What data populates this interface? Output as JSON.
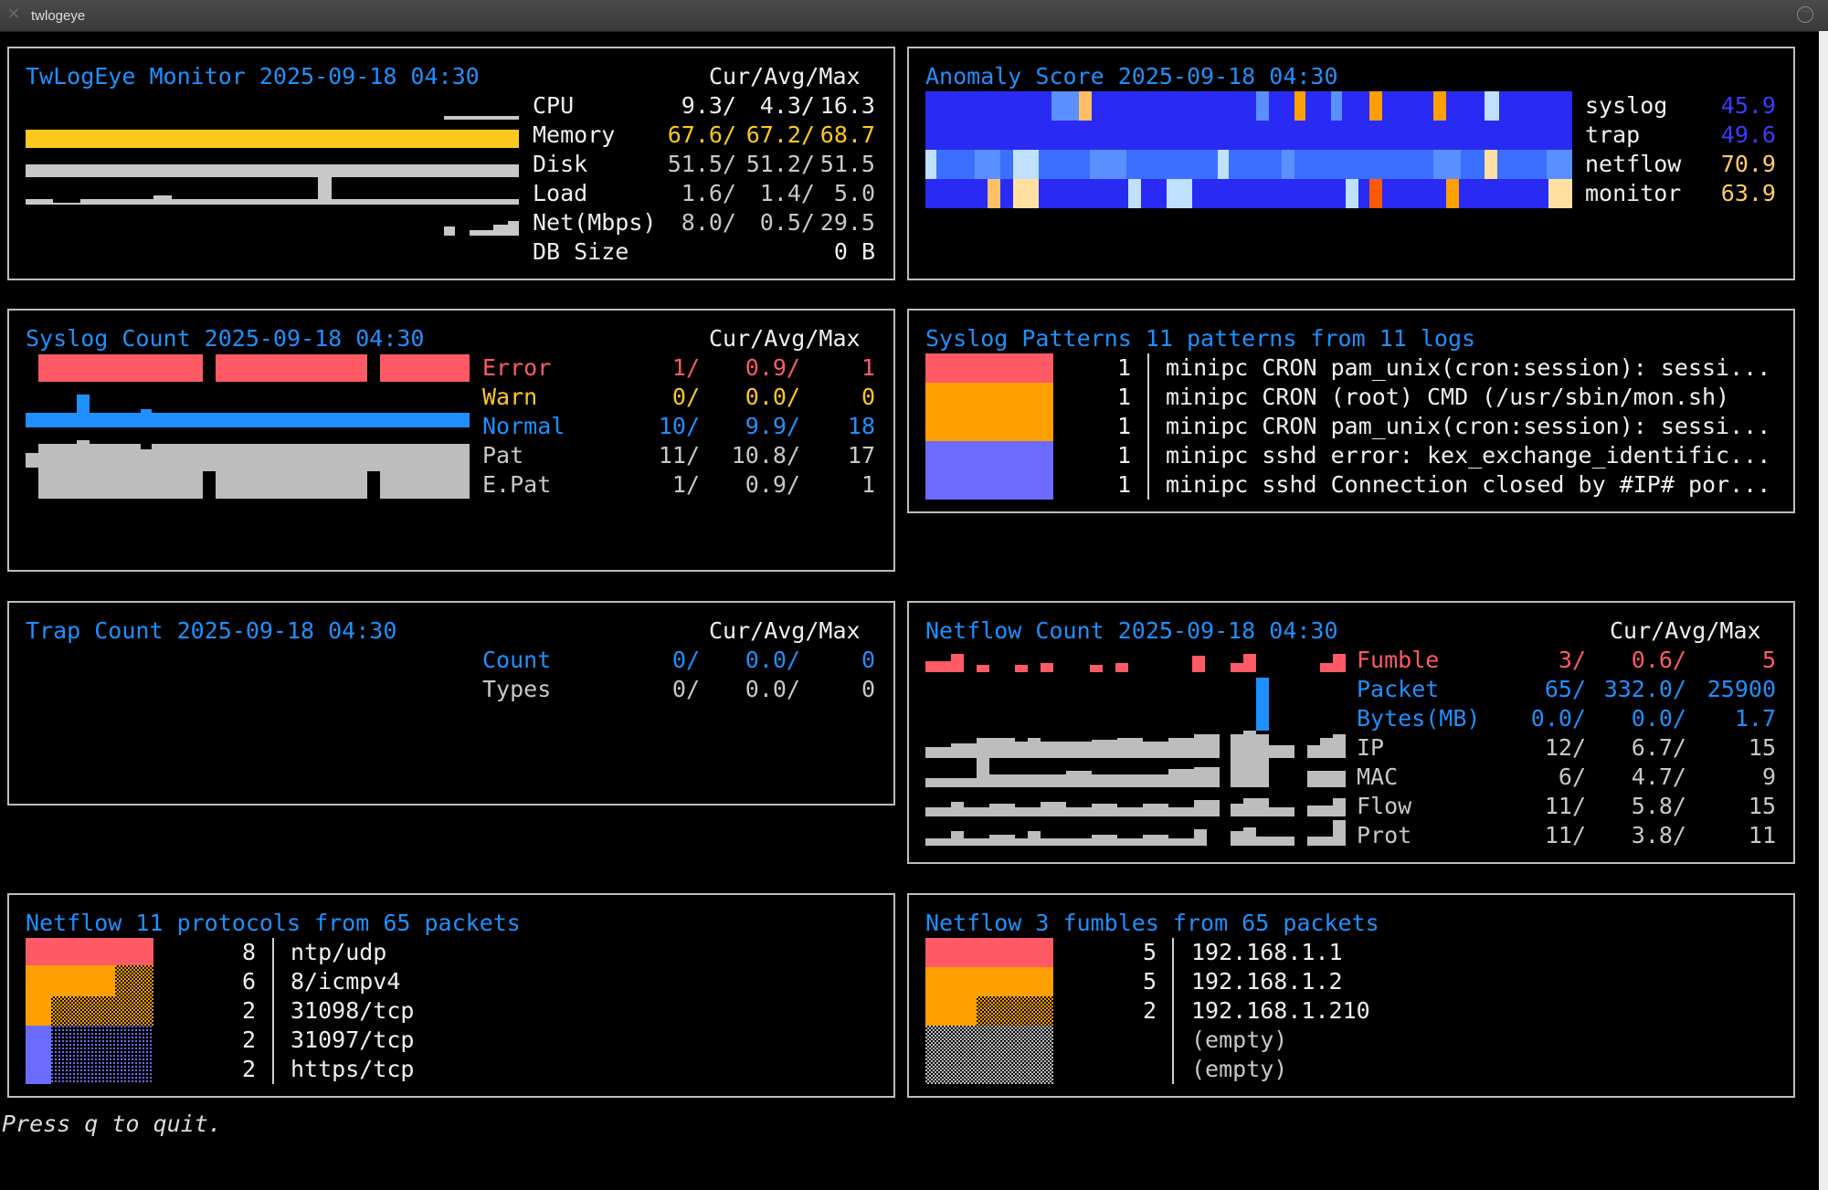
{
  "window": {
    "title": "twlogeye"
  },
  "colors": {
    "panel_title": "#1e90ff",
    "error": "#ff5a65",
    "warn": "#ffc81f",
    "normal": "#1e90ff",
    "gray": "#bdbdbd",
    "orange": "#ff9f00",
    "purple": "#6b6bff"
  },
  "monitor": {
    "title": "TwLogEye Monitor 2025-09-18 04:30",
    "header": "Cur/Avg/Max",
    "rows": [
      {
        "label": "CPU",
        "cur": "9.3/",
        "avg": "4.3/",
        "max": "16.3"
      },
      {
        "label": "Memory",
        "cur": "67.6/",
        "avg": "67.2/",
        "max": "68.7"
      },
      {
        "label": "Disk",
        "cur": "51.5/",
        "avg": "51.2/",
        "max": "51.5"
      },
      {
        "label": "Load",
        "cur": "1.6/",
        "avg": "1.4/",
        "max": "5.0"
      },
      {
        "label": "Net(Mbps)",
        "cur": "8.0/",
        "avg": "0.5/",
        "max": "29.5"
      },
      {
        "label": "DB Size",
        "cur": "",
        "avg": "",
        "max": "0 B"
      }
    ]
  },
  "anomaly": {
    "title": "Anomaly Score 2025-09-18 04:30",
    "rows": [
      {
        "label": "syslog",
        "value": "45.9"
      },
      {
        "label": "trap",
        "value": "49.6"
      },
      {
        "label": "netflow",
        "value": "70.9"
      },
      {
        "label": "monitor",
        "value": "63.9"
      }
    ]
  },
  "syslog_count": {
    "title": "Syslog Count 2025-09-18 04:30",
    "header": "Cur/Avg/Max",
    "rows": [
      {
        "label": "Error",
        "cur": "1/",
        "avg": "0.9/",
        "max": "1"
      },
      {
        "label": "Warn",
        "cur": "0/",
        "avg": "0.0/",
        "max": "0"
      },
      {
        "label": "Normal",
        "cur": "10/",
        "avg": "9.9/",
        "max": "18"
      },
      {
        "label": "Pat",
        "cur": "11/",
        "avg": "10.8/",
        "max": "17"
      },
      {
        "label": "E.Pat",
        "cur": "1/",
        "avg": "0.9/",
        "max": "1"
      }
    ]
  },
  "syslog_patterns": {
    "title": "Syslog Patterns 11 patterns from 11 logs",
    "rows": [
      {
        "count": "1",
        "text": "minipc CRON pam_unix(cron:session): sessi..."
      },
      {
        "count": "1",
        "text": "minipc CRON (root) CMD (/usr/sbin/mon.sh)"
      },
      {
        "count": "1",
        "text": "minipc CRON pam_unix(cron:session): sessi..."
      },
      {
        "count": "1",
        "text": "minipc sshd error: kex_exchange_identific..."
      },
      {
        "count": "1",
        "text": "minipc sshd Connection closed by #IP# por..."
      }
    ]
  },
  "trap_count": {
    "title": "Trap Count 2025-09-18 04:30",
    "header": "Cur/Avg/Max",
    "rows": [
      {
        "label": "Count",
        "cur": "0/",
        "avg": "0.0/",
        "max": "0"
      },
      {
        "label": "Types",
        "cur": "0/",
        "avg": "0.0/",
        "max": "0"
      }
    ]
  },
  "netflow_count": {
    "title": "Netflow Count 2025-09-18 04:30",
    "header": "Cur/Avg/Max",
    "rows": [
      {
        "label": "Fumble",
        "cur": "3/",
        "avg": "0.6/",
        "max": "5"
      },
      {
        "label": "Packet",
        "cur": "65/",
        "avg": "332.0/",
        "max": "25900"
      },
      {
        "label": "Bytes(MB)",
        "cur": "0.0/",
        "avg": "0.0/",
        "max": "1.7"
      },
      {
        "label": "IP",
        "cur": "12/",
        "avg": "6.7/",
        "max": "15"
      },
      {
        "label": "MAC",
        "cur": "6/",
        "avg": "4.7/",
        "max": "9"
      },
      {
        "label": "Flow",
        "cur": "11/",
        "avg": "5.8/",
        "max": "15"
      },
      {
        "label": "Prot",
        "cur": "11/",
        "avg": "3.8/",
        "max": "11"
      }
    ]
  },
  "netflow_protocols": {
    "title": "Netflow 11 protocols from 65 packets",
    "rows": [
      {
        "count": "8",
        "text": "ntp/udp"
      },
      {
        "count": "6",
        "text": "8/icmpv4"
      },
      {
        "count": "2",
        "text": "31098/tcp"
      },
      {
        "count": "2",
        "text": "31097/tcp"
      },
      {
        "count": "2",
        "text": "https/tcp"
      }
    ]
  },
  "netflow_fumbles": {
    "title": "Netflow 3 fumbles from 65 packets",
    "rows": [
      {
        "count": "5",
        "text": "192.168.1.1"
      },
      {
        "count": "5",
        "text": "192.168.1.2"
      },
      {
        "count": "2",
        "text": "192.168.1.210"
      },
      {
        "count": "",
        "text": "(empty)"
      },
      {
        "count": "",
        "text": "(empty)"
      }
    ]
  },
  "footer": {
    "text": "Press q to quit."
  }
}
